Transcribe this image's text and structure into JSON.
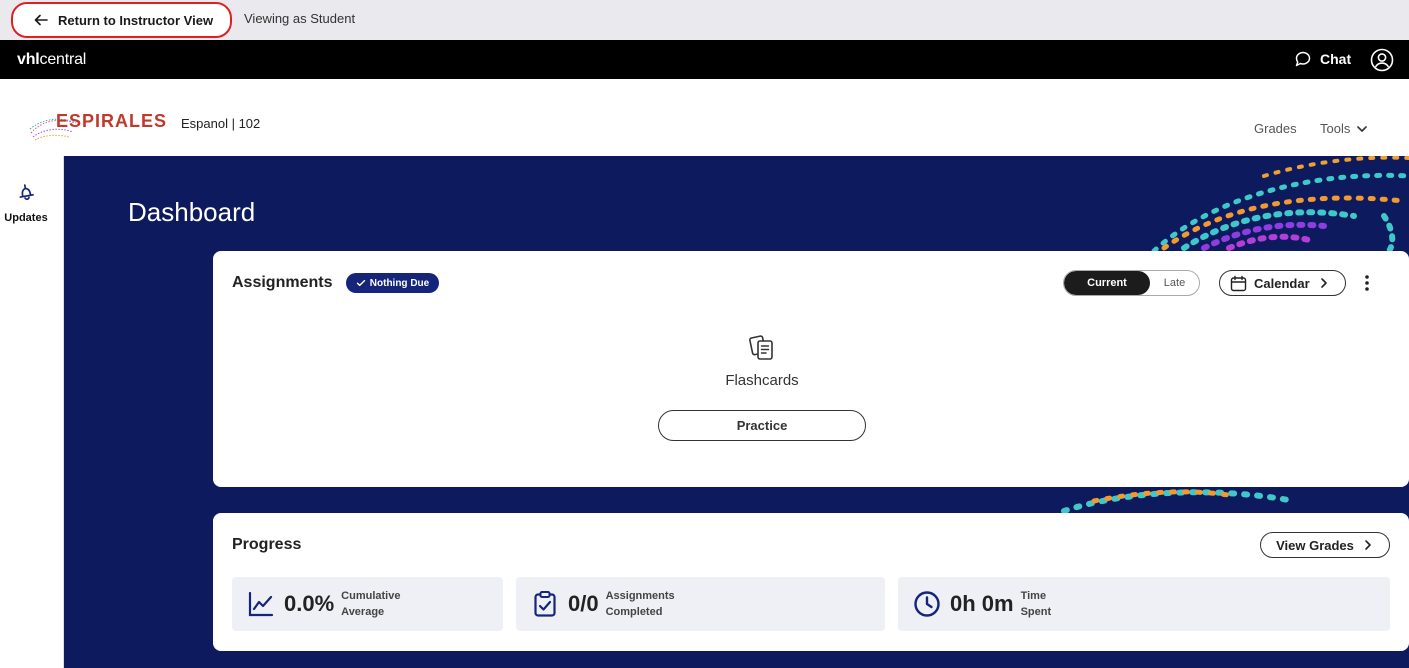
{
  "instructor_bar": {
    "return_label": "Return to Instructor View",
    "viewing_label": "Viewing as Student"
  },
  "topbar": {
    "logo_bold": "vhl",
    "logo_rest": "central",
    "chat_label": "Chat"
  },
  "header": {
    "brand": "ESPIRALES",
    "course": "Espanol | 102",
    "nav": {
      "grades": "Grades",
      "tools": "Tools"
    }
  },
  "sidebar": {
    "updates_label": "Updates"
  },
  "main": {
    "title": "Dashboard",
    "assignments": {
      "title": "Assignments",
      "badge": "Nothing Due",
      "toggle": {
        "current": "Current",
        "late": "Late"
      },
      "calendar_label": "Calendar",
      "flashcards_label": "Flashcards",
      "practice_label": "Practice"
    },
    "progress": {
      "title": "Progress",
      "view_grades_label": "View Grades",
      "stats": [
        {
          "value": "0.0%",
          "label_1": "Cumulative",
          "label_2": "Average",
          "icon": "line-chart-icon"
        },
        {
          "value": "0/0",
          "label_1": "Assignments",
          "label_2": "Completed",
          "icon": "clipboard-check-icon"
        },
        {
          "value": "0h 0m",
          "label_1": "Time",
          "label_2": "Spent",
          "icon": "clock-icon"
        }
      ]
    }
  },
  "colors": {
    "brand_red": "#c0392b",
    "navy": "#0d1a5e",
    "badge_blue": "#15267a",
    "highlight_red": "#e02020"
  }
}
